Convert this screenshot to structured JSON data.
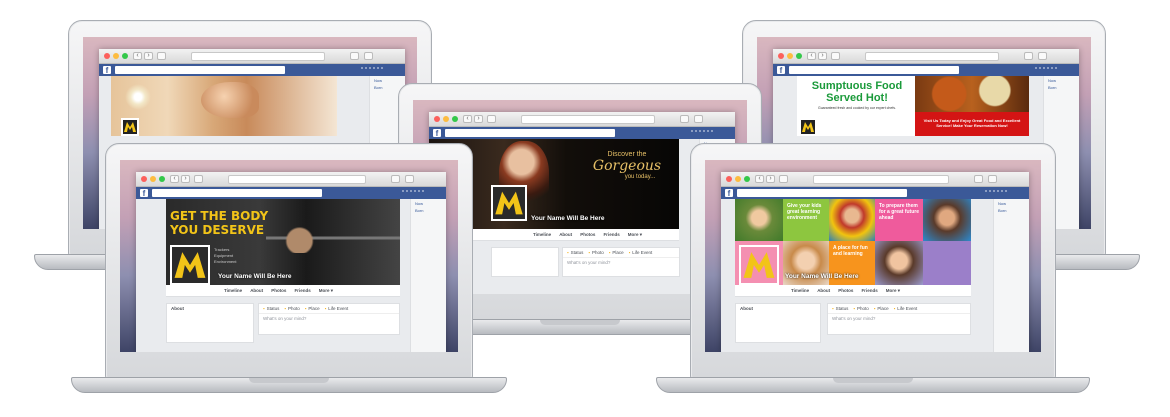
{
  "tabs": {
    "timeline": "Timeline",
    "about": "About",
    "photos": "Photos",
    "friends": "Friends",
    "more": "More ▾"
  },
  "composer": {
    "status": "Status",
    "photo": "Photo",
    "place": "Place",
    "life_event": "Life Event",
    "prompt": "What's on your mind?"
  },
  "sidebar": {
    "item1": "Now",
    "item2": "Born"
  },
  "about_label": "About",
  "profile_name": "Your Name Will Be Here",
  "gym": {
    "line1": "GET THE BODY",
    "line2": "YOU DESERVE",
    "features": [
      "Trackers",
      "Equipment",
      "Environment"
    ]
  },
  "beauty": {
    "line1": "Discover the",
    "line2": "Gorgeous",
    "line3": "you today..."
  },
  "food": {
    "title1": "Sumptuous Food",
    "title2": "Served Hot!",
    "subtitle": "Guaranteed fresh and cooked by our expert chefs.",
    "promo": "Visit Us Today and Enjoy Great Food and Excellent Service! Make Your Reservation Now!"
  },
  "school": {
    "t1": "Give your kids great learning environment",
    "t2": "To prepare them for a great future ahead",
    "t3": "A place for fun and learning"
  },
  "colors": {
    "fb_blue": "#3b5998",
    "logo_gold": "#f2c418",
    "food_green": "#1a9a3a",
    "food_red": "#d41414"
  }
}
